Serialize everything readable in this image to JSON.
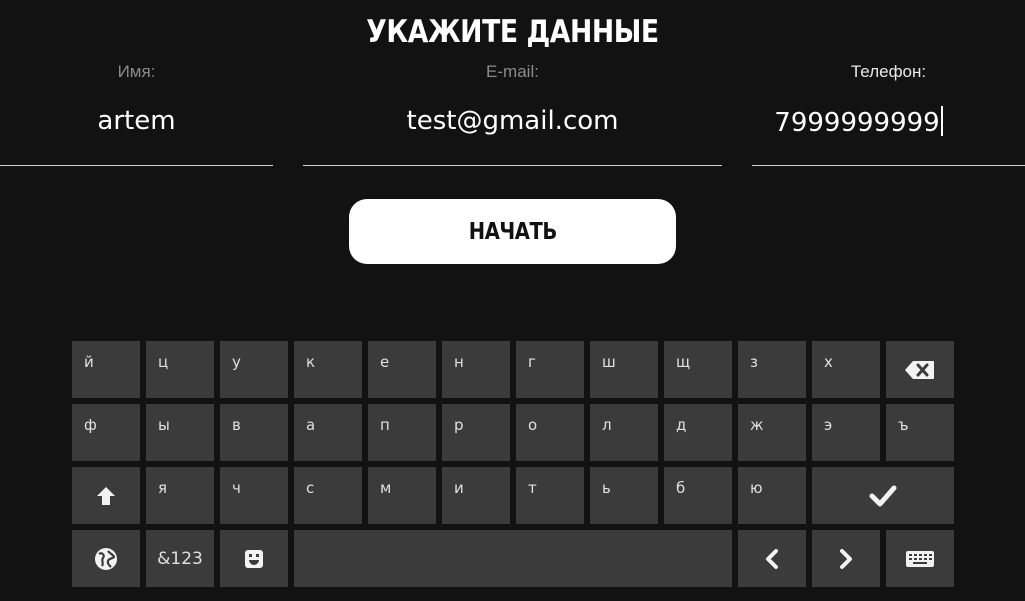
{
  "title": "УКАЖИТЕ ДАННЫЕ",
  "fields": {
    "name": {
      "label": "Имя:",
      "value": "artem"
    },
    "email": {
      "label": "E-mail:",
      "value": "test@gmail.com"
    },
    "phone": {
      "label": "Телефон:",
      "value": "7999999999"
    }
  },
  "start_button": "НАЧАТЬ",
  "keyboard": {
    "row1": [
      "й",
      "ц",
      "у",
      "к",
      "е",
      "н",
      "г",
      "ш",
      "щ",
      "з",
      "х"
    ],
    "row2": [
      "ф",
      "ы",
      "в",
      "а",
      "п",
      "р",
      "о",
      "л",
      "д",
      "ж",
      "э",
      "ъ"
    ],
    "row3": [
      "я",
      "ч",
      "с",
      "м",
      "и",
      "т",
      "ь",
      "б",
      "ю"
    ],
    "symbols_key": "&123",
    "icons": {
      "backspace": "backspace-icon",
      "shift": "shift-arrow-icon",
      "enter": "checkmark-icon",
      "language": "globe-icon",
      "emoji": "emoji-icon",
      "left": "chevron-left-icon",
      "right": "chevron-right-icon",
      "hide": "keyboard-icon"
    }
  },
  "colors": {
    "background": "#121212",
    "key": "#3b3b3b",
    "button": "#ffffff"
  }
}
